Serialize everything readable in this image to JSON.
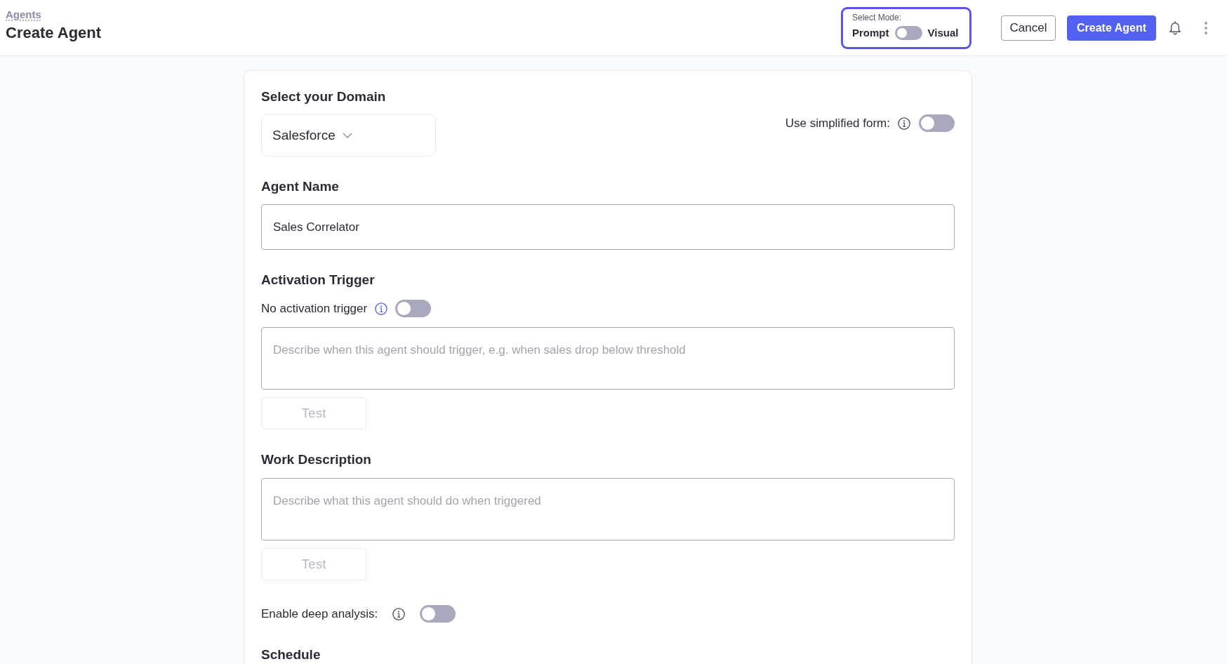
{
  "header": {
    "breadcrumb": "Agents",
    "title": "Create Agent",
    "mode_switch": {
      "label": "Select Mode:",
      "left_label": "Prompt",
      "right_label": "Visual",
      "on": false
    },
    "buttons": [
      {
        "label": "Cancel",
        "kind": "secondary"
      },
      {
        "label": "Create Agent",
        "kind": "primary"
      }
    ]
  },
  "form": {
    "domain": {
      "label": "Select your Domain",
      "value": "Salesforce"
    },
    "simplified_form": {
      "label": "Use simplified form:",
      "on": false
    },
    "agent_name": {
      "label": "Agent Name",
      "value": "Sales Correlator"
    },
    "activation_trigger": {
      "label": "Activation Trigger",
      "toggle_label": "No activation trigger",
      "on": false,
      "placeholder": "Describe when this agent should trigger, e.g. when sales drop below threshold",
      "test_button": {
        "label": "Test",
        "disabled": true
      }
    },
    "work_description": {
      "label": "Work Description",
      "placeholder": "Describe what this agent should do when triggered",
      "test_button": {
        "label": "Test",
        "disabled": true
      }
    },
    "deep_analysis": {
      "label": "Enable deep analysis:",
      "on": false
    },
    "schedule": {
      "label": "Schedule"
    }
  }
}
